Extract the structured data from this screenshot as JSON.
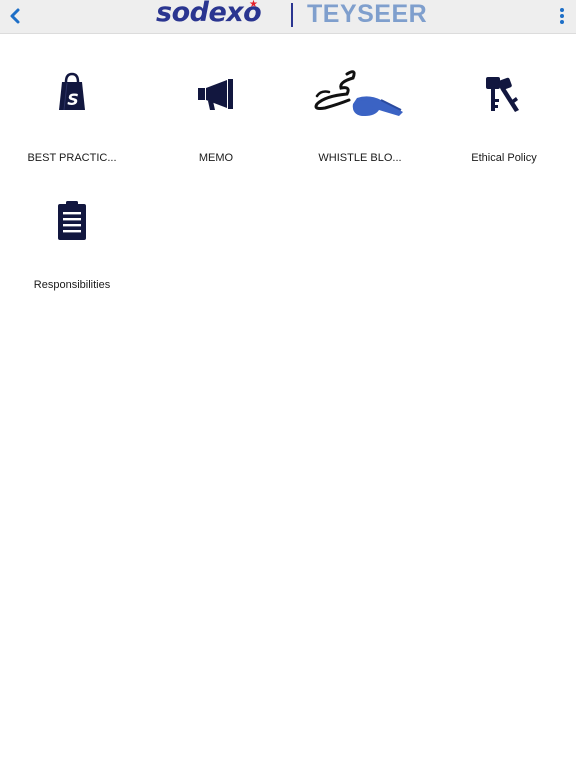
{
  "header": {
    "back_icon": "chevron-left-icon",
    "menu_icon": "vertical-ellipsis-icon",
    "logo": {
      "brand": "sodexo",
      "partner": "TEYSEER"
    },
    "accent_color": "#1e6fc7"
  },
  "tiles": [
    {
      "label": "BEST PRACTIC...",
      "icon": "shopping-bag-icon"
    },
    {
      "label": "MEMO",
      "icon": "megaphone-icon"
    },
    {
      "label": "WHISTLE BLO...",
      "icon": "whistle-icon"
    },
    {
      "label": "Ethical Policy",
      "icon": "keys-icon"
    },
    {
      "label": "Responsibilities",
      "icon": "clipboard-icon"
    }
  ],
  "colors": {
    "icon_navy": "#12173f",
    "whistle_blue": "#3b63c4"
  }
}
